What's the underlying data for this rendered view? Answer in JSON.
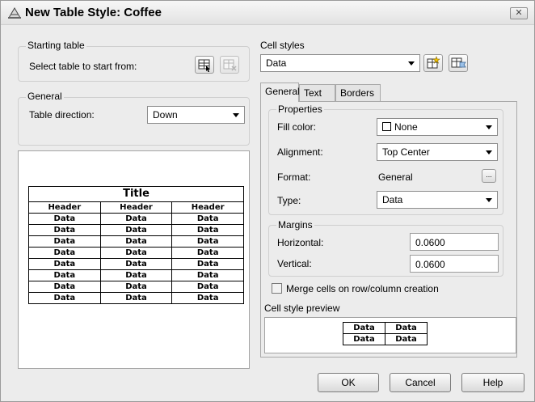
{
  "window": {
    "title": "New Table Style: Coffee",
    "close_label": "✕"
  },
  "starting_table": {
    "legend": "Starting table",
    "prompt": "Select table to start from:"
  },
  "general": {
    "legend": "General",
    "direction_label": "Table direction:",
    "direction_value": "Down"
  },
  "preview": {
    "title": "Title",
    "headers": [
      "Header",
      "Header",
      "Header"
    ],
    "rows": [
      [
        "Data",
        "Data",
        "Data"
      ],
      [
        "Data",
        "Data",
        "Data"
      ],
      [
        "Data",
        "Data",
        "Data"
      ],
      [
        "Data",
        "Data",
        "Data"
      ],
      [
        "Data",
        "Data",
        "Data"
      ],
      [
        "Data",
        "Data",
        "Data"
      ],
      [
        "Data",
        "Data",
        "Data"
      ],
      [
        "Data",
        "Data",
        "Data"
      ]
    ]
  },
  "cell_styles": {
    "legend": "Cell styles",
    "selected": "Data",
    "tabs": [
      "General",
      "Text",
      "Borders"
    ],
    "properties": {
      "legend": "Properties",
      "fill_color_label": "Fill color:",
      "fill_color_value": "None",
      "alignment_label": "Alignment:",
      "alignment_value": "Top Center",
      "format_label": "Format:",
      "format_value": "General",
      "format_button": "...",
      "type_label": "Type:",
      "type_value": "Data"
    },
    "margins": {
      "legend": "Margins",
      "horizontal_label": "Horizontal:",
      "horizontal_value": "0.0600",
      "vertical_label": "Vertical:",
      "vertical_value": "0.0600"
    },
    "merge_label": "Merge cells on row/column creation",
    "merge_checked": false,
    "preview_legend": "Cell style preview",
    "preview_cells": [
      "Data",
      "Data",
      "Data",
      "Data"
    ]
  },
  "buttons": {
    "ok": "OK",
    "cancel": "Cancel",
    "help": "Help"
  }
}
